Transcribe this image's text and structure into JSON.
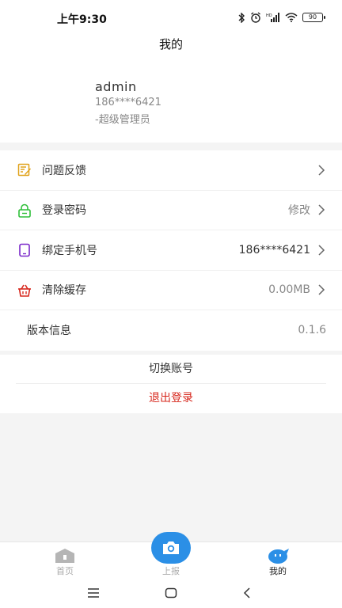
{
  "status": {
    "time": "上午9:30",
    "battery": "90"
  },
  "header": {
    "title": "我的"
  },
  "profile": {
    "name": "admin",
    "phone": "186****6421",
    "role": "-超级管理员"
  },
  "menu": {
    "items": [
      {
        "label": "问题反馈",
        "value": "",
        "icon": "feedback-edit-icon"
      },
      {
        "label": "登录密码",
        "value": "修改",
        "icon": "lock-icon"
      },
      {
        "label": "绑定手机号",
        "value": "186****6421",
        "icon": "phone-icon"
      },
      {
        "label": "清除缓存",
        "value": "0.00MB",
        "icon": "basket-icon"
      },
      {
        "label": "版本信息",
        "value": "0.1.6",
        "icon": ""
      }
    ]
  },
  "actions": {
    "switch_account": "切换账号",
    "logout": "退出登录"
  },
  "tabbar": {
    "tabs": [
      {
        "label": "首页",
        "icon": "home-icon"
      },
      {
        "label": "上报",
        "icon": "camera-icon"
      },
      {
        "label": "我的",
        "icon": "chat-bubble-icon"
      }
    ],
    "active": "我的"
  },
  "colors": {
    "accent": "#2b8fe6",
    "danger": "#d7281e",
    "feedback_icon": "#e0a21a",
    "lock_icon": "#2fbf3a",
    "phone_icon": "#7a28c9",
    "basket_icon": "#d7281e"
  }
}
